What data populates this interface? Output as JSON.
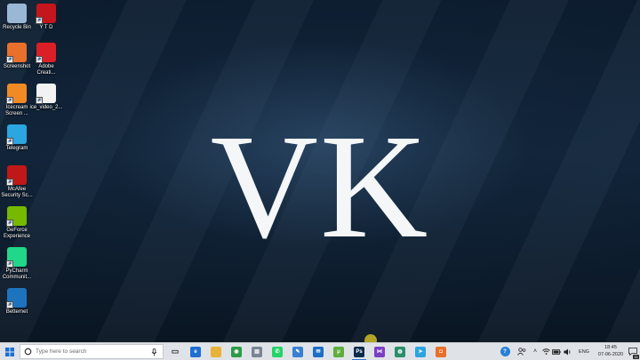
{
  "wallpaper": {
    "text": "VK"
  },
  "desktop_icons": [
    {
      "label": "Recycle Bin",
      "icon": "recycle-bin-icon",
      "color": "#9ab8d6"
    },
    {
      "label": "Y T D",
      "icon": "ytd-downloader-icon",
      "color": "#c4161c"
    },
    {
      "label": "Screenshot",
      "icon": "screenshot-icon",
      "color": "#e8702a"
    },
    {
      "label": "Adobe Creati...",
      "icon": "adobe-creative-cloud-icon",
      "color": "#da1f26"
    },
    {
      "label": "Icecream Screen ...",
      "icon": "icecream-recorder-icon",
      "color": "#f08a24"
    },
    {
      "label": "ice_video_2...",
      "icon": "video-file-icon",
      "color": "#f2f2f2"
    },
    {
      "label": "Telegram",
      "icon": "telegram-icon",
      "color": "#2ca5e0"
    },
    {
      "label": "McAfee Security Sc...",
      "icon": "mcafee-icon",
      "color": "#c01818"
    },
    {
      "label": "GeForce Experience",
      "icon": "geforce-icon",
      "color": "#76b900"
    },
    {
      "label": "PyCharm Communit...",
      "icon": "pycharm-icon",
      "color": "#21d789"
    },
    {
      "label": "Betternet",
      "icon": "betternet-icon",
      "color": "#1e73be"
    }
  ],
  "taskbar": {
    "search_placeholder": "Type here to search",
    "apps": [
      {
        "name": "task-view",
        "icon": "task-view-icon",
        "color": "#444444",
        "glyph": "▭"
      },
      {
        "name": "edge",
        "icon": "edge-icon",
        "color": "#1f6fd1",
        "glyph": "e"
      },
      {
        "name": "file-explorer",
        "icon": "folder-icon",
        "color": "#e8b23a",
        "glyph": ""
      },
      {
        "name": "chrome",
        "icon": "chrome-icon",
        "color": "#2e9b48",
        "glyph": "◉"
      },
      {
        "name": "file-manager",
        "icon": "files-icon",
        "color": "#7a8593",
        "glyph": "▤"
      },
      {
        "name": "whatsapp",
        "icon": "whatsapp-icon",
        "color": "#25d366",
        "glyph": "✆"
      },
      {
        "name": "notes",
        "icon": "notes-icon",
        "color": "#3b7fd4",
        "glyph": "✎"
      },
      {
        "name": "mail",
        "icon": "mail-icon",
        "color": "#1c6fc4",
        "glyph": "✉"
      },
      {
        "name": "torrent",
        "icon": "utorrent-icon",
        "color": "#5fad3b",
        "glyph": "μ"
      },
      {
        "name": "photoshop",
        "icon": "photoshop-icon",
        "color": "#0b2b4d",
        "glyph": "Ps",
        "active": true
      },
      {
        "name": "visual-studio",
        "icon": "visual-studio-icon",
        "color": "#7b3fc4",
        "glyph": "⋈"
      },
      {
        "name": "browser",
        "icon": "globe-icon",
        "color": "#2a8f6a",
        "glyph": "◍"
      },
      {
        "name": "telegram",
        "icon": "telegram-icon",
        "color": "#2ca5e0",
        "glyph": "➤"
      },
      {
        "name": "screenshot",
        "icon": "screenshot-icon",
        "color": "#e8702a",
        "glyph": "◘"
      }
    ],
    "tray": {
      "language": "ENG",
      "time": "18:45",
      "date": "07-06-2020",
      "notification_count": "11"
    }
  }
}
